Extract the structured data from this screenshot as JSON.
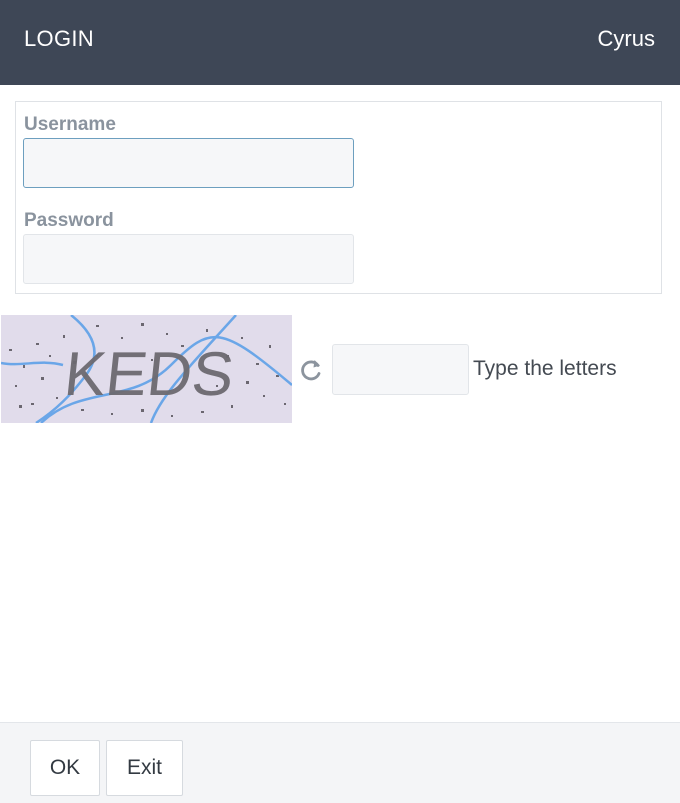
{
  "header": {
    "title": "LOGIN",
    "user": "Cyrus"
  },
  "form": {
    "username": {
      "label": "Username",
      "value": ""
    },
    "password": {
      "label": "Password",
      "value": ""
    }
  },
  "captcha": {
    "image_text": "KEDS",
    "refresh_icon": "refresh-icon",
    "input_value": "",
    "hint": "Type the letters"
  },
  "footer": {
    "ok_label": "OK",
    "exit_label": "Exit"
  },
  "colors": {
    "header_bg": "#3e4756",
    "label": "#8a939e",
    "focus_border": "#6d9fbf",
    "captcha_bg": "#e1dceb",
    "captcha_lines": "#6aa6e8"
  }
}
